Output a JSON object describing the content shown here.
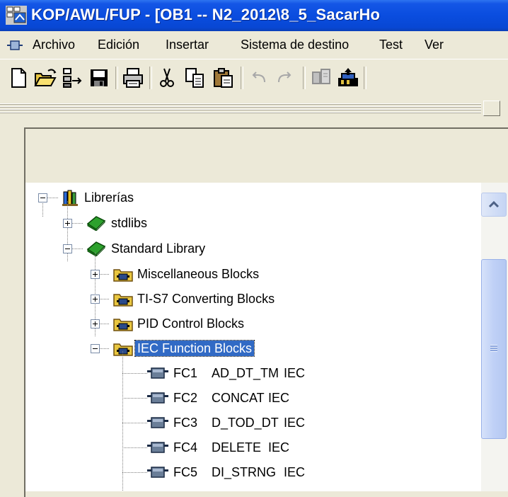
{
  "window": {
    "title": "KOP/AWL/FUP  - [OB1 -- N2_2012\\8_5_SacarHo"
  },
  "menu": {
    "items": [
      "Archivo",
      "Edición",
      "Insertar",
      "Sistema de destino",
      "Test",
      "Ver"
    ]
  },
  "toolbar": {
    "buttons": [
      "new-icon",
      "open-icon",
      "accessible-nodes-icon",
      "save-icon",
      "print-icon",
      "cut-icon",
      "copy-icon",
      "paste-icon",
      "undo-icon",
      "redo-icon",
      "load-icon",
      "monitor-icon"
    ]
  },
  "tree": {
    "root": "Librerías",
    "stdlibs": "stdlibs",
    "standard_library": "Standard Library",
    "folders": [
      "Miscellaneous Blocks",
      "TI-S7 Converting Blocks",
      "PID Control Blocks",
      "IEC Function Blocks"
    ],
    "blocks": [
      {
        "id": "FC1",
        "name": "AD_DT_TM",
        "lib": "IEC"
      },
      {
        "id": "FC2",
        "name": "CONCAT",
        "lib": "IEC"
      },
      {
        "id": "FC3",
        "name": "D_TOD_DT",
        "lib": "IEC"
      },
      {
        "id": "FC4",
        "name": "DELETE",
        "lib": "IEC"
      },
      {
        "id": "FC5",
        "name": "DI_STRNG",
        "lib": "IEC"
      }
    ],
    "selected": "IEC Function Blocks"
  },
  "colors": {
    "title_bar": "#0A4DDF",
    "selection": "#316AC5",
    "book_green": "#2DA12D"
  }
}
